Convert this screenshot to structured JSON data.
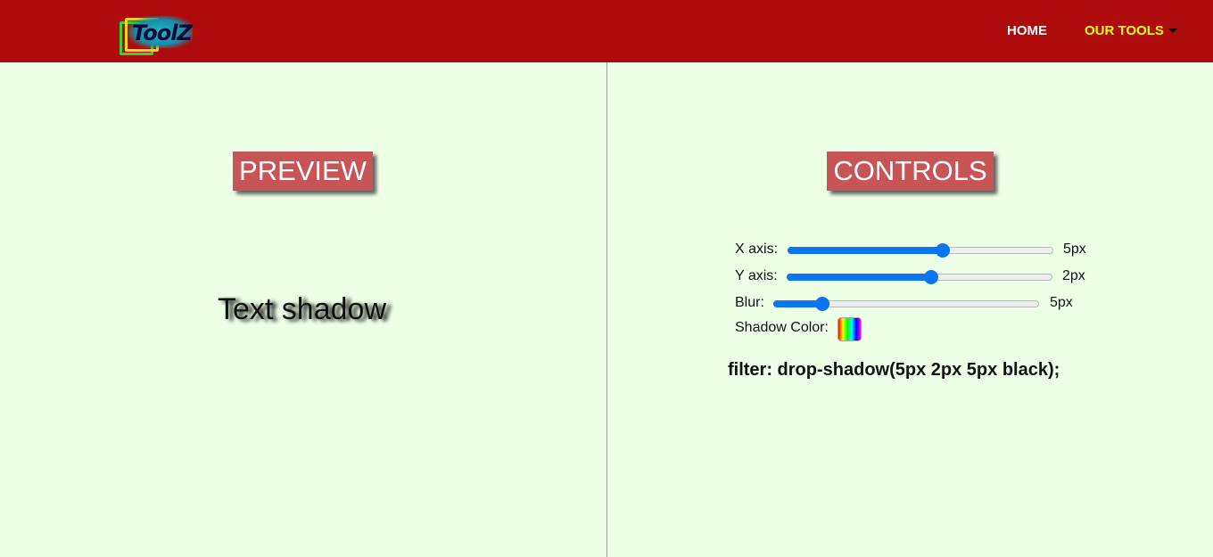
{
  "header": {
    "logo_text": "ToolZ",
    "nav": {
      "home_label": "HOME",
      "tools_label": "OUR TOOLS"
    }
  },
  "preview": {
    "title": "PREVIEW",
    "sample_text": "Text shadow"
  },
  "controls": {
    "title": "CONTROLS",
    "sliders": [
      {
        "label": "X axis:",
        "value_text": "5px",
        "fraction": 0.58
      },
      {
        "label": "Y axis:",
        "value_text": "2px",
        "fraction": 0.54
      },
      {
        "label": "Blur:",
        "value_text": "5px",
        "fraction": 0.18
      }
    ],
    "shadow_color_label": "Shadow Color:",
    "filter_output": "filter: drop-shadow(5px 2px 5px black);"
  },
  "colors": {
    "header_bg": "#ae0c0c",
    "page_bg": "#eeffe8",
    "title_bg": "#c85555",
    "accent": "#0a75f0",
    "tools_link": "#ffff00"
  }
}
